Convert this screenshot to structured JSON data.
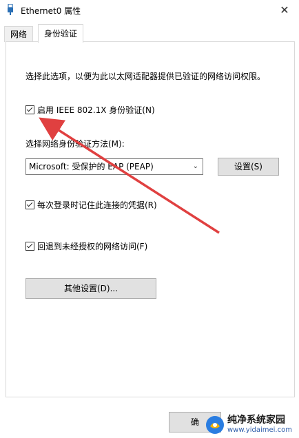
{
  "window": {
    "title": "Ethernet0 属性",
    "close_label": "✕"
  },
  "tabs": [
    {
      "label": "网络",
      "active": false
    },
    {
      "label": "身份验证",
      "active": true
    }
  ],
  "content": {
    "description": "选择此选项，以便为此以太网适配器提供已验证的网络访问权限。",
    "enable_8021x": {
      "label": "启用 IEEE 802.1X 身份验证(N)",
      "checked": true
    },
    "method_label": "选择网络身份验证方法(M):",
    "method_select": {
      "value": "Microsoft: 受保护的 EAP (PEAP)"
    },
    "settings_button": "设置(S)",
    "remember_credentials": {
      "label": "每次登录时记住此连接的凭据(R)",
      "checked": true
    },
    "fallback_unauthorized": {
      "label": "回退到未经授权的网络访问(F)",
      "checked": true
    },
    "other_settings_button": "其他设置(D)..."
  },
  "footer": {
    "ok_button": "确"
  },
  "watermark": {
    "name": "纯净系统家园",
    "url": "www.yidaimei.com"
  },
  "colors": {
    "arrow": "#e04040",
    "url": "#2a5aa8"
  }
}
